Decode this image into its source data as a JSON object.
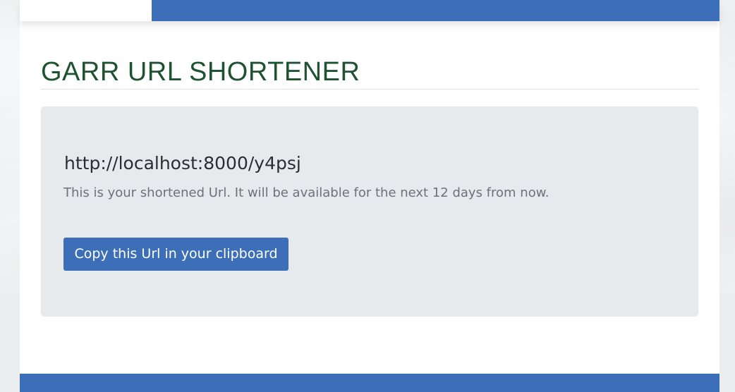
{
  "page": {
    "title": "GARR URL SHORTENER"
  },
  "result": {
    "short_url": "http://localhost:8000/y4psj",
    "description": "This is your shortened Url. It will be available for the next 12 days from now.",
    "copy_button_label": "Copy this Url in your clipboard"
  },
  "colors": {
    "brand_blue": "#3d6fb8",
    "title_green": "#1f5230",
    "panel_bg": "#e7eaed"
  }
}
